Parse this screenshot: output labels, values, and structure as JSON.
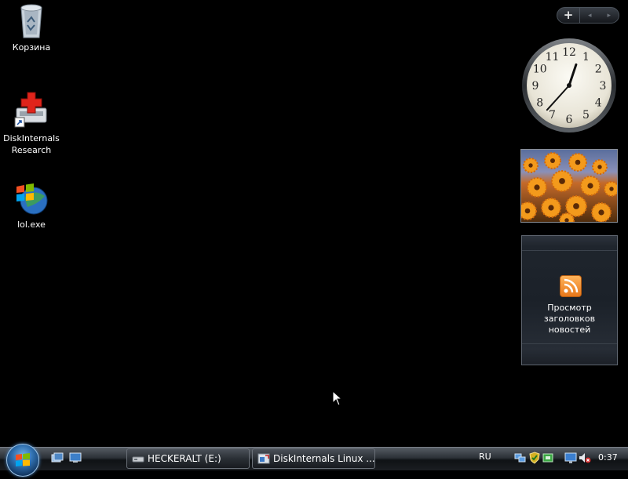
{
  "desktop": {
    "icons": [
      {
        "label": "Корзина",
        "icon": "recycle-bin-icon"
      },
      {
        "label": "DiskInternals Research",
        "label_lines": [
          "DiskInternals",
          "Research"
        ],
        "icon": "diskinternals-shortcut-icon"
      },
      {
        "label": "lol.exe",
        "icon": "windows-logo-icon"
      }
    ]
  },
  "sidebar": {
    "add_label": "+",
    "prev_label": "◂",
    "next_label": "▸",
    "clock": {
      "hour": 12,
      "minute": 37,
      "numerals": [
        "12",
        "1",
        "2",
        "3",
        "4",
        "5",
        "6",
        "7",
        "8",
        "9",
        "10",
        "11"
      ]
    },
    "slideshow": {
      "subject": "orange flowers photo"
    },
    "feed": {
      "text_lines": [
        "Просмотр заголовков",
        "новостей"
      ],
      "icon": "rss-icon"
    }
  },
  "taskbar": {
    "start_icon": "windows-start-orb",
    "quick_launch": [
      "switch-windows-icon",
      "show-desktop-icon"
    ],
    "tasks": [
      {
        "label": "HECKERALT (E:)",
        "icon": "drive-icon"
      },
      {
        "label": "DiskInternals Linux ...",
        "icon": "diskinternals-app-icon"
      }
    ],
    "language": "RU",
    "tray_icons": [
      "network-icon",
      "security-icon",
      "power-icon",
      "display-icon",
      "volume-muted-icon"
    ],
    "time": "0:37"
  },
  "colors": {
    "desktop_bg": "#000000",
    "rss_orange": "#f08a24"
  }
}
